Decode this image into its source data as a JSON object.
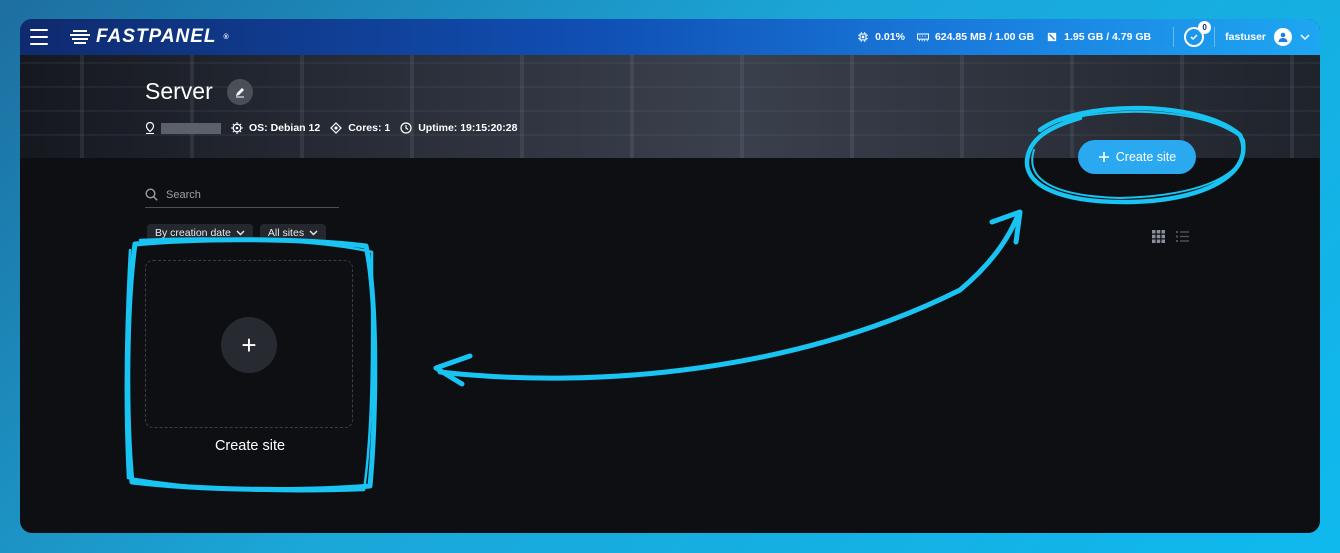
{
  "topbar": {
    "logo_text": "FASTPANEL",
    "logo_registered": "®",
    "cpu": "0.01%",
    "ram": "624.85 MB / 1.00 GB",
    "disk": "1.95 GB / 4.79 GB",
    "notifications_count": "0",
    "username": "fastuser"
  },
  "hero": {
    "title": "Server",
    "os": "OS: Debian 12",
    "cores": "Cores: 1",
    "uptime": "Uptime: 19:15:20:28"
  },
  "toolbar": {
    "search_placeholder": "Search",
    "sort_label": "By creation date",
    "filter_label": "All sites",
    "create_label": "Create site"
  },
  "card": {
    "plus": "+",
    "label": "Create site"
  },
  "colors": {
    "accent": "#2aa9f0",
    "annotation": "#19c3f2",
    "background": "#0e0f13"
  }
}
